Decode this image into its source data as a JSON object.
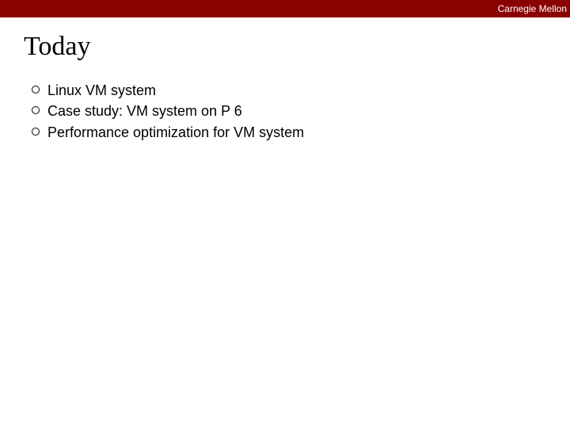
{
  "header": {
    "organization": "Carnegie Mellon"
  },
  "slide": {
    "title": "Today",
    "bullets": [
      {
        "text": "Linux VM system"
      },
      {
        "text": "Case study: VM system on P 6"
      },
      {
        "text": "Performance optimization for VM system"
      }
    ]
  }
}
